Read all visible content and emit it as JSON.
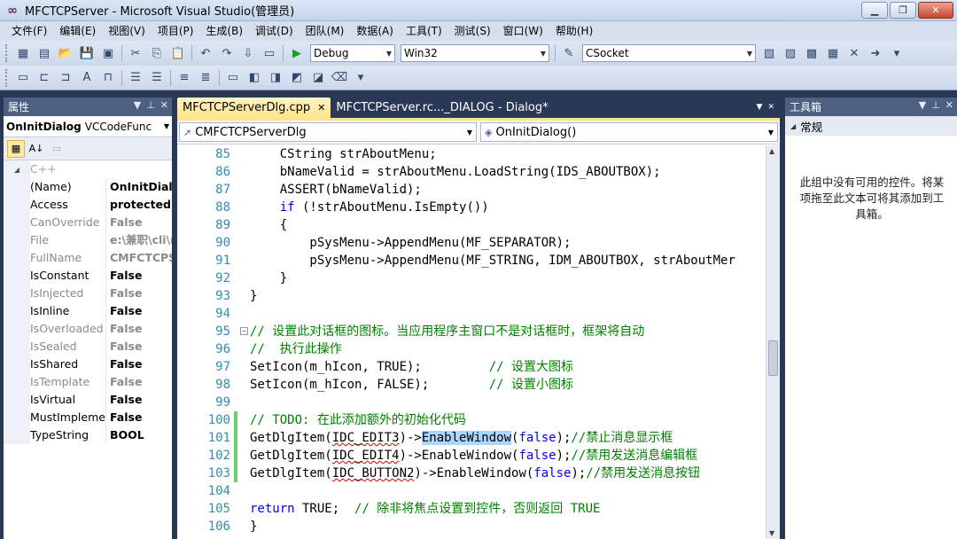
{
  "window": {
    "title": "MFCTCPServer - Microsoft Visual Studio(管理员)"
  },
  "menu": [
    "文件(F)",
    "编辑(E)",
    "视图(V)",
    "项目(P)",
    "生成(B)",
    "调试(D)",
    "团队(M)",
    "数据(A)",
    "工具(T)",
    "测试(S)",
    "窗口(W)",
    "帮助(H)"
  ],
  "toolbar": {
    "config": "Debug",
    "platform": "Win32",
    "find": "CSocket"
  },
  "properties": {
    "header": "属性",
    "object": "OnInitDialog",
    "object_type": "VCCodeFunc",
    "category": "C++",
    "rows": [
      {
        "name": "(Name)",
        "value": "OnInitDialo",
        "gray": false
      },
      {
        "name": "Access",
        "value": "protected",
        "gray": false
      },
      {
        "name": "CanOverride",
        "value": "False",
        "gray": true
      },
      {
        "name": "File",
        "value": "e:\\兼职\\cli\\r",
        "gray": true
      },
      {
        "name": "FullName",
        "value": "CMFCTCPSe",
        "gray": true
      },
      {
        "name": "IsConstant",
        "value": "False",
        "gray": false
      },
      {
        "name": "IsInjected",
        "value": "False",
        "gray": true
      },
      {
        "name": "IsInline",
        "value": "False",
        "gray": false
      },
      {
        "name": "IsOverloaded",
        "value": "False",
        "gray": true
      },
      {
        "name": "IsSealed",
        "value": "False",
        "gray": true
      },
      {
        "name": "IsShared",
        "value": "False",
        "gray": false
      },
      {
        "name": "IsTemplate",
        "value": "False",
        "gray": true
      },
      {
        "name": "IsVirtual",
        "value": "False",
        "gray": false
      },
      {
        "name": "MustImpleme",
        "value": "False",
        "gray": false
      },
      {
        "name": "TypeString",
        "value": "BOOL",
        "gray": false
      }
    ]
  },
  "editor": {
    "tabs": [
      {
        "label": "MFCTCPServerDlg.cpp",
        "active": true
      },
      {
        "label": "MFCTCPServer.rc..._DIALOG - Dialog*",
        "active": false
      }
    ],
    "class_combo": "CMFCTCPServerDlg",
    "member_combo": "OnInitDialog()",
    "lines": [
      {
        "n": "85",
        "t": "    CString strAboutMenu;"
      },
      {
        "n": "86",
        "t": "    bNameValid = strAboutMenu.LoadString(IDS_ABOUTBOX);"
      },
      {
        "n": "87",
        "t": "    ASSERT(bNameValid);"
      },
      {
        "n": "88",
        "t": "    if (!strAboutMenu.IsEmpty())"
      },
      {
        "n": "89",
        "t": "    {"
      },
      {
        "n": "90",
        "t": "        pSysMenu->AppendMenu(MF_SEPARATOR);"
      },
      {
        "n": "91",
        "t": "        pSysMenu->AppendMenu(MF_STRING, IDM_ABOUTBOX, strAboutMer"
      },
      {
        "n": "92",
        "t": "    }"
      },
      {
        "n": "93",
        "t": "}"
      },
      {
        "n": "94",
        "t": ""
      },
      {
        "n": "95",
        "t": "// 设置此对话框的图标。当应用程序主窗口不是对话框时，框架将自动"
      },
      {
        "n": "96",
        "t": "//  执行此操作"
      },
      {
        "n": "97",
        "t": "SetIcon(m_hIcon, TRUE);         // 设置大图标"
      },
      {
        "n": "98",
        "t": "SetIcon(m_hIcon, FALSE);        // 设置小图标"
      },
      {
        "n": "99",
        "t": ""
      },
      {
        "n": "100",
        "t": "// TODO: 在此添加额外的初始化代码"
      },
      {
        "n": "101",
        "t": "GetDlgItem(IDC_EDIT3)->EnableWindow(false);//禁止消息显示框"
      },
      {
        "n": "102",
        "t": "GetDlgItem(IDC_EDIT4)->EnableWindow(false);//禁用发送消息编辑框"
      },
      {
        "n": "103",
        "t": "GetDlgItem(IDC_BUTTON2)->EnableWindow(false);//禁用发送消息按钮"
      },
      {
        "n": "104",
        "t": ""
      },
      {
        "n": "105",
        "t": "return TRUE;  // 除非将焦点设置到控件，否则返回 TRUE"
      },
      {
        "n": "106",
        "t": "}"
      }
    ]
  },
  "toolbox": {
    "header": "工具箱",
    "category": "常规",
    "message": "此组中没有可用的控件。将某项拖至此文本可将其添加到工具箱。"
  }
}
